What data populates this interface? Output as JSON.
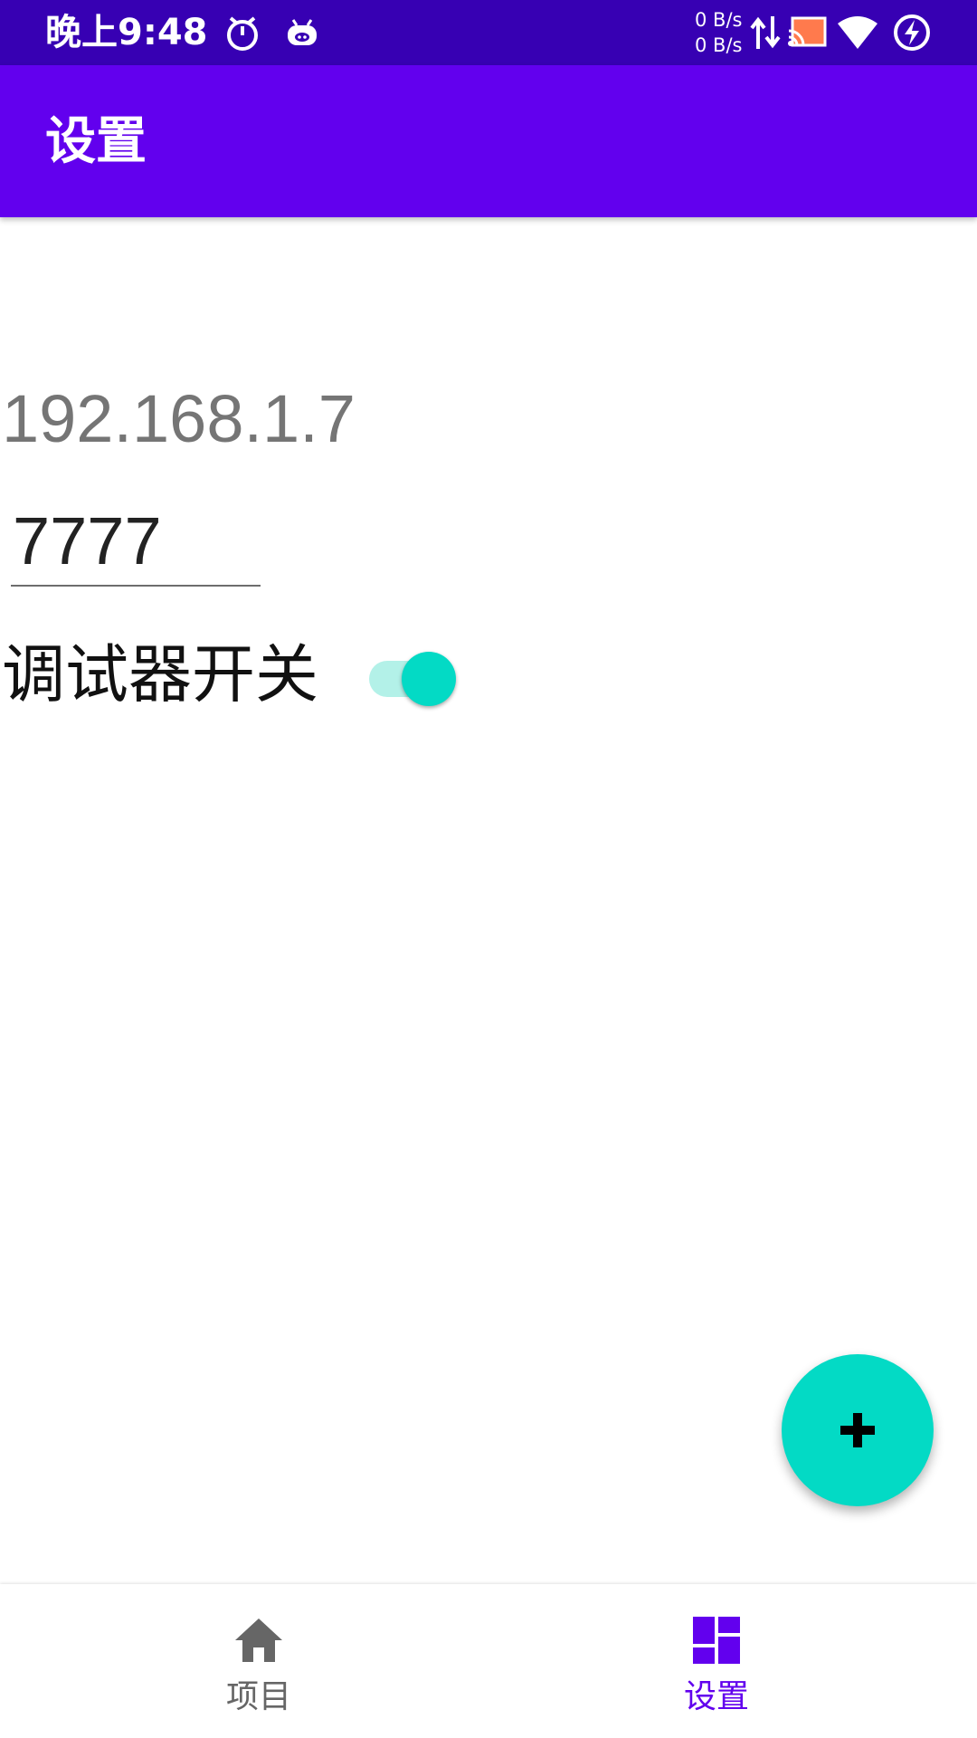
{
  "status_bar": {
    "time": "晚上9:48",
    "net_up": "0 B/s",
    "net_down": "0 B/s",
    "icons": [
      "stopwatch-icon",
      "android-bug-icon",
      "data-arrows-icon",
      "cast-icon",
      "wifi-icon",
      "battery-charging-icon"
    ]
  },
  "app_bar": {
    "title": "设置"
  },
  "settings": {
    "ip_address": "192.168.1.7",
    "port_value": "7777",
    "debug_switch_label": "调试器开关",
    "debug_switch_on": true
  },
  "fab": {
    "icon": "plus-icon"
  },
  "bottom_nav": {
    "items": [
      {
        "label": "项目",
        "icon": "home-icon",
        "active": false
      },
      {
        "label": "设置",
        "icon": "dashboard-icon",
        "active": true
      }
    ]
  },
  "colors": {
    "status_bar": "#3700b3",
    "primary": "#6200ee",
    "accent": "#03dac5",
    "switch_track": "#b3f1e8"
  }
}
